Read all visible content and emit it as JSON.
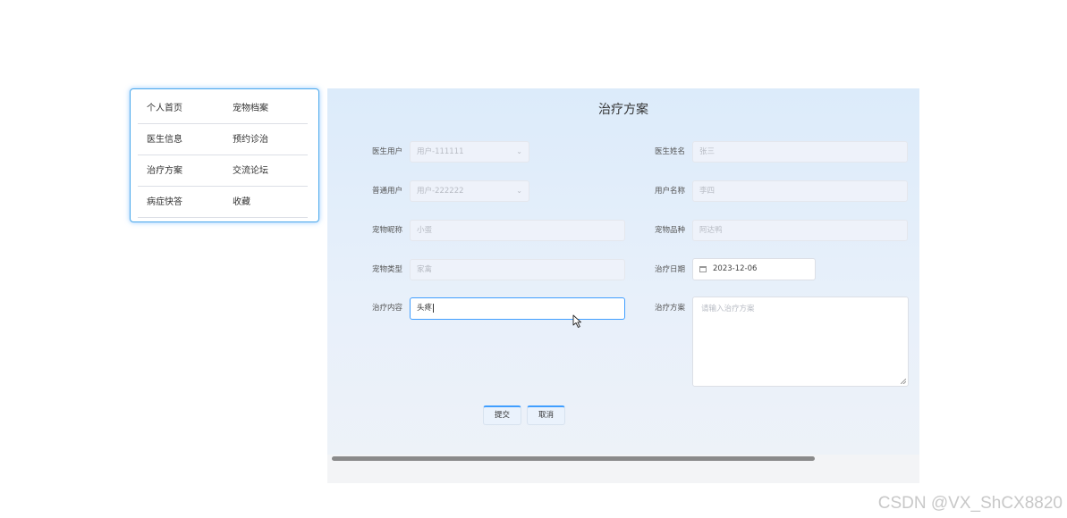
{
  "nav": {
    "rows": [
      [
        "个人首页",
        "宠物档案"
      ],
      [
        "医生信息",
        "预约诊治"
      ],
      [
        "治疗方案",
        "交流论坛"
      ],
      [
        "病症快答",
        "收藏"
      ]
    ]
  },
  "form": {
    "title": "治疗方案",
    "doctor_user": {
      "label": "医生用户",
      "value": "用户-111111"
    },
    "doctor_name": {
      "label": "医生姓名",
      "value": "张三"
    },
    "normal_user": {
      "label": "普通用户",
      "value": "用户-222222"
    },
    "user_name": {
      "label": "用户名称",
      "value": "李四"
    },
    "pet_nickname": {
      "label": "宠物昵称",
      "value": "小蛋"
    },
    "pet_breed": {
      "label": "宠物品种",
      "value": "阿达鸭"
    },
    "pet_type": {
      "label": "宠物类型",
      "value": "家禽"
    },
    "treat_date": {
      "label": "治疗日期",
      "value": "2023-12-06"
    },
    "treat_content": {
      "label": "治疗内容",
      "value": "头疼"
    },
    "treat_plan": {
      "label": "治疗方案",
      "placeholder": "请输入治疗方案"
    },
    "submit_label": "提交",
    "cancel_label": "取消"
  },
  "watermark": "CSDN @VX_ShCX8820",
  "colors": {
    "accent": "#409eff",
    "panel_bg": "#dcebfa"
  }
}
